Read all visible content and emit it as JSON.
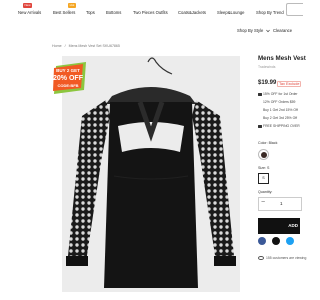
{
  "nav": {
    "items": [
      {
        "label": "New Arrivals",
        "badge": "New",
        "badge_color": "#e0453c"
      },
      {
        "label": "Best Sellers",
        "badge": "Hot",
        "badge_color": "#f5a623"
      },
      {
        "label": "Tops"
      },
      {
        "label": "Bottoms"
      },
      {
        "label": "Two Pieces Outfits"
      },
      {
        "label": "Coats&Jackets"
      },
      {
        "label": "Sleep&Lounge"
      },
      {
        "label": "Shop By Trend"
      },
      {
        "label": "Shop By Style"
      },
      {
        "label": "Clearance"
      }
    ]
  },
  "breadcrumb": {
    "home": "Home",
    "current": "Mens Mesh Vest Set SKU67865"
  },
  "promo_badge": {
    "line1": "BUY 2 GET",
    "line2": "20% OFF",
    "line3": "CODE:BFB",
    "color_main": "#f15a24",
    "color_accent": "#8cc63f"
  },
  "product": {
    "title": "Mens Mesh Vest",
    "subtitle": "Tradewinds",
    "price": "$19.99",
    "price_tag": "Tax Exclude",
    "promos": [
      "15% OFF for 1st Order",
      "12% OFF Orders $59",
      "Buy 1 Get 2nd 15% Off",
      "Buy 2 Get 3rd 25% Off"
    ],
    "shipping": "FREE SHIPPING OVER",
    "color_label": "Color: Black",
    "size_label": "Size: S",
    "size_value": "S",
    "quantity_label": "Quantity:",
    "quantity_value": "1",
    "add_to_cart": "ADD",
    "viewers": "155 customers are viewing"
  },
  "social_colors": [
    "#3b5998",
    "#111111",
    "#1da1f2"
  ]
}
